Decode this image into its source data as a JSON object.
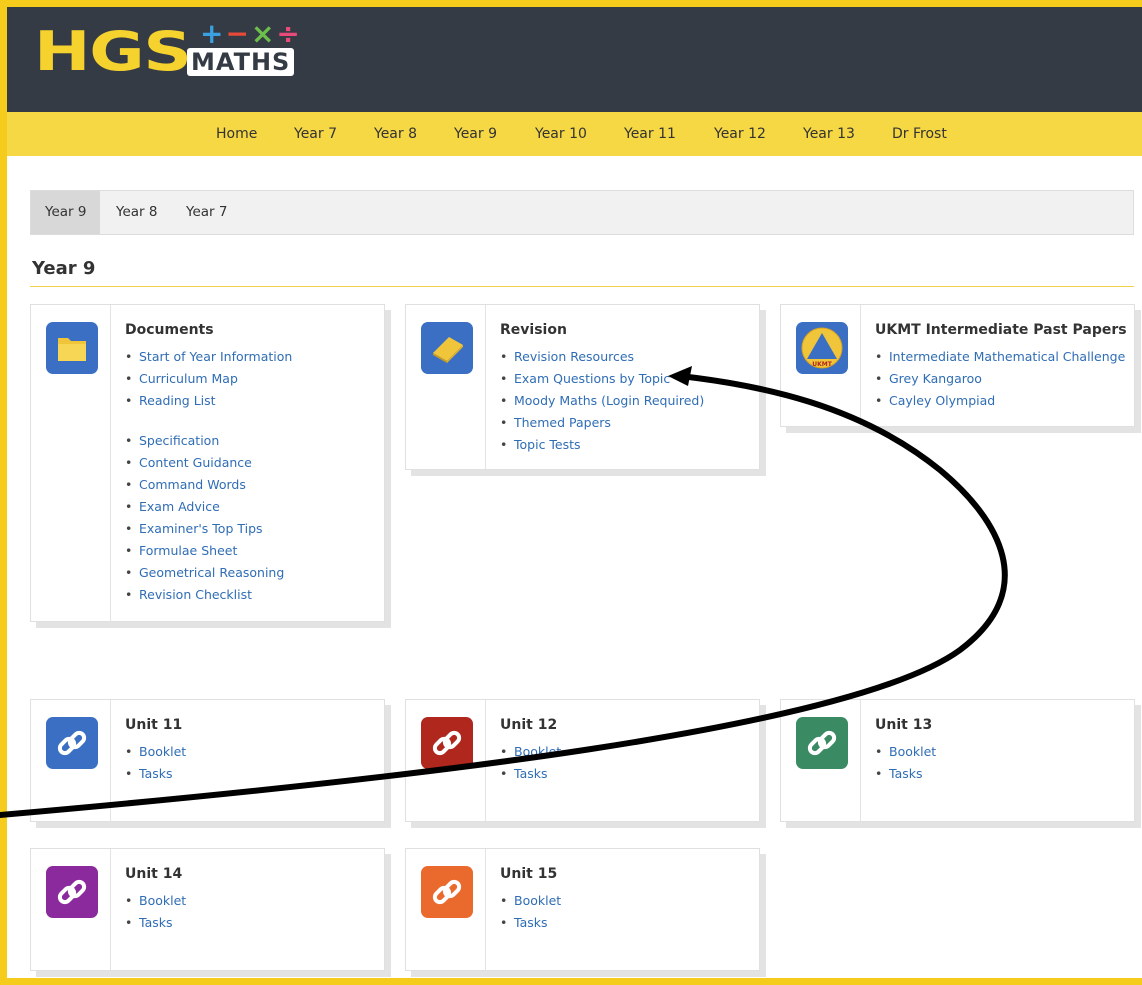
{
  "brand": {
    "hgs": "HGS",
    "ops": [
      "+",
      "−",
      "×",
      "÷"
    ],
    "maths": "MATHS",
    "colors": {
      "topbar": "#353b44",
      "nav": "#f6d844",
      "accent": "#f6d22e",
      "link": "#2f6db5"
    }
  },
  "nav": [
    "Home",
    "Year 7",
    "Year 8",
    "Year 9",
    "Year 10",
    "Year 11",
    "Year 12",
    "Year 13",
    "Dr Frost"
  ],
  "tabs": [
    "Year 9",
    "Year 8",
    "Year 7"
  ],
  "heading": "Year 9",
  "cards": [
    {
      "title": "Documents",
      "icon": "folder-icon",
      "color": "#3a6fc4",
      "items": [
        "Start of Year Information",
        "Curriculum Map",
        "Reading List",
        "Specification",
        "Content Guidance",
        "Command Words",
        "Exam Advice",
        "Examiner's Top Tips",
        "Formulae Sheet",
        "Geometrical Reasoning",
        "Revision Checklist"
      ]
    },
    {
      "title": "Revision",
      "icon": "book-icon",
      "color": "#3a6fc4",
      "items": [
        "Revision Resources",
        "Exam Questions by Topic",
        "Moody Maths (Login Required)",
        "Themed Papers",
        "Topic Tests"
      ]
    },
    {
      "title": "UKMT Intermediate Past Papers",
      "icon": "ukmt-icon",
      "color": "#3a6fc4",
      "icon_label": "UKMT",
      "items": [
        "Intermediate Mathematical Challenge",
        "Grey Kangaroo",
        "Cayley Olympiad"
      ]
    },
    {
      "title": "Unit 11",
      "icon": "link-icon",
      "color": "#3a6fc4",
      "items": [
        "Booklet",
        "Tasks"
      ]
    },
    {
      "title": "Unit 12",
      "icon": "link-icon",
      "color": "#b0271d",
      "items": [
        "Booklet",
        "Tasks"
      ]
    },
    {
      "title": "Unit 13",
      "icon": "link-icon",
      "color": "#3a8a63",
      "items": [
        "Booklet",
        "Tasks"
      ]
    },
    {
      "title": "Unit 14",
      "icon": "link-icon",
      "color": "#8a2a9c",
      "items": [
        "Booklet",
        "Tasks"
      ]
    },
    {
      "title": "Unit 15",
      "icon": "link-icon",
      "color": "#ea6a2d",
      "items": [
        "Booklet",
        "Tasks"
      ]
    }
  ]
}
